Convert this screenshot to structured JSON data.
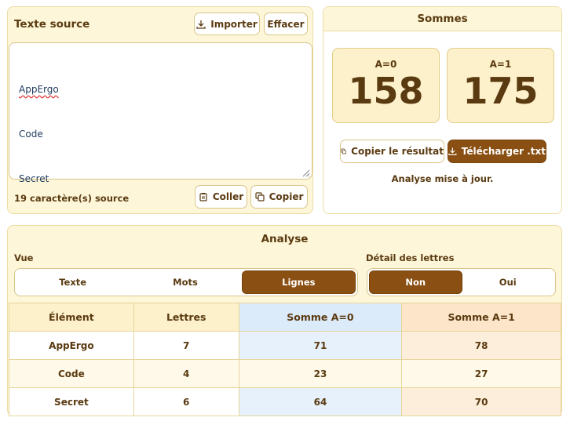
{
  "source": {
    "title": "Texte source",
    "import_label": "Importer",
    "clear_label": "Effacer",
    "lines": [
      "AppErgo",
      "Code",
      "Secret"
    ],
    "char_count": "19 caractère(s) source",
    "paste_label": "Coller",
    "copy_label": "Copier"
  },
  "sums": {
    "title": "Sommes",
    "a0_label": "A=0",
    "a0_value": "158",
    "a1_label": "A=1",
    "a1_value": "175",
    "copy_result_label": "Copier le résultat",
    "download_label": "Télécharger .txt",
    "status": "Analyse mise à jour."
  },
  "analysis": {
    "title": "Analyse",
    "view_label": "Vue",
    "view_options": [
      "Texte",
      "Mots",
      "Lignes"
    ],
    "view_selected": "Lignes",
    "detail_label": "Détail des lettres",
    "detail_options": [
      "Non",
      "Oui"
    ],
    "detail_selected": "Non",
    "columns": [
      "Élément",
      "Lettres",
      "Somme A=0",
      "Somme A=1"
    ],
    "rows": [
      [
        "AppErgo",
        "7",
        "71",
        "78"
      ],
      [
        "Code",
        "4",
        "23",
        "27"
      ],
      [
        "Secret",
        "6",
        "64",
        "70"
      ]
    ]
  },
  "colors": {
    "accent": "#8a4f12",
    "panel_bg": "#fdf6d8",
    "a0_column": "#dcebf9",
    "a1_column": "#fde5c9"
  },
  "icons": [
    "download-icon",
    "copy-icon",
    "clipboard-icon"
  ]
}
